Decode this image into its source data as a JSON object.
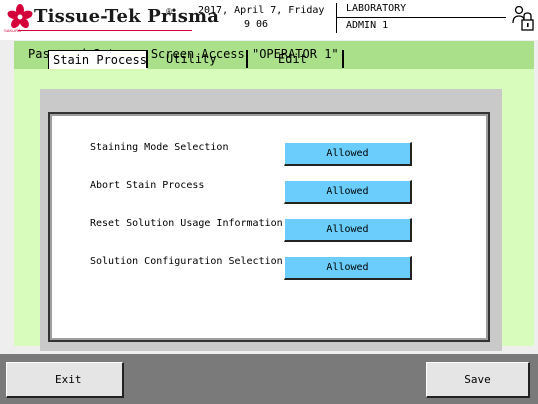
{
  "header": {
    "brand": "Tissue-Tek Prisma",
    "registered": "®",
    "company": "SAKURA",
    "date": "2017, April 7, Friday",
    "time": "9 06",
    "role": "LABORATORY",
    "user": "ADMIN 1",
    "icons": {
      "logo": "sakura-flower-icon",
      "lock": "lock-user-icon"
    }
  },
  "breadcrumb": "Password Setup > Screen Access  \"OPERATOR 1\"",
  "tabs": [
    {
      "label": "Stain Process",
      "active": true
    },
    {
      "label": "Utility",
      "active": false
    },
    {
      "label": "Edit",
      "active": false
    }
  ],
  "permissions": [
    {
      "label": "Staining Mode Selection",
      "value": "Allowed"
    },
    {
      "label": "Abort Stain Process",
      "value": "Allowed"
    },
    {
      "label": "Reset Solution Usage Information",
      "value": "Allowed"
    },
    {
      "label": "Solution Configuration Selection",
      "value": "Allowed"
    }
  ],
  "footer": {
    "exit_label": "Exit",
    "save_label": "Save"
  },
  "colors": {
    "panel": "#d7fcbc",
    "breadcrumb_bar": "#a9e089",
    "allowed_button": "#6acdfb",
    "footer": "#7a7a7a",
    "brand_accent": "#d4003a"
  }
}
